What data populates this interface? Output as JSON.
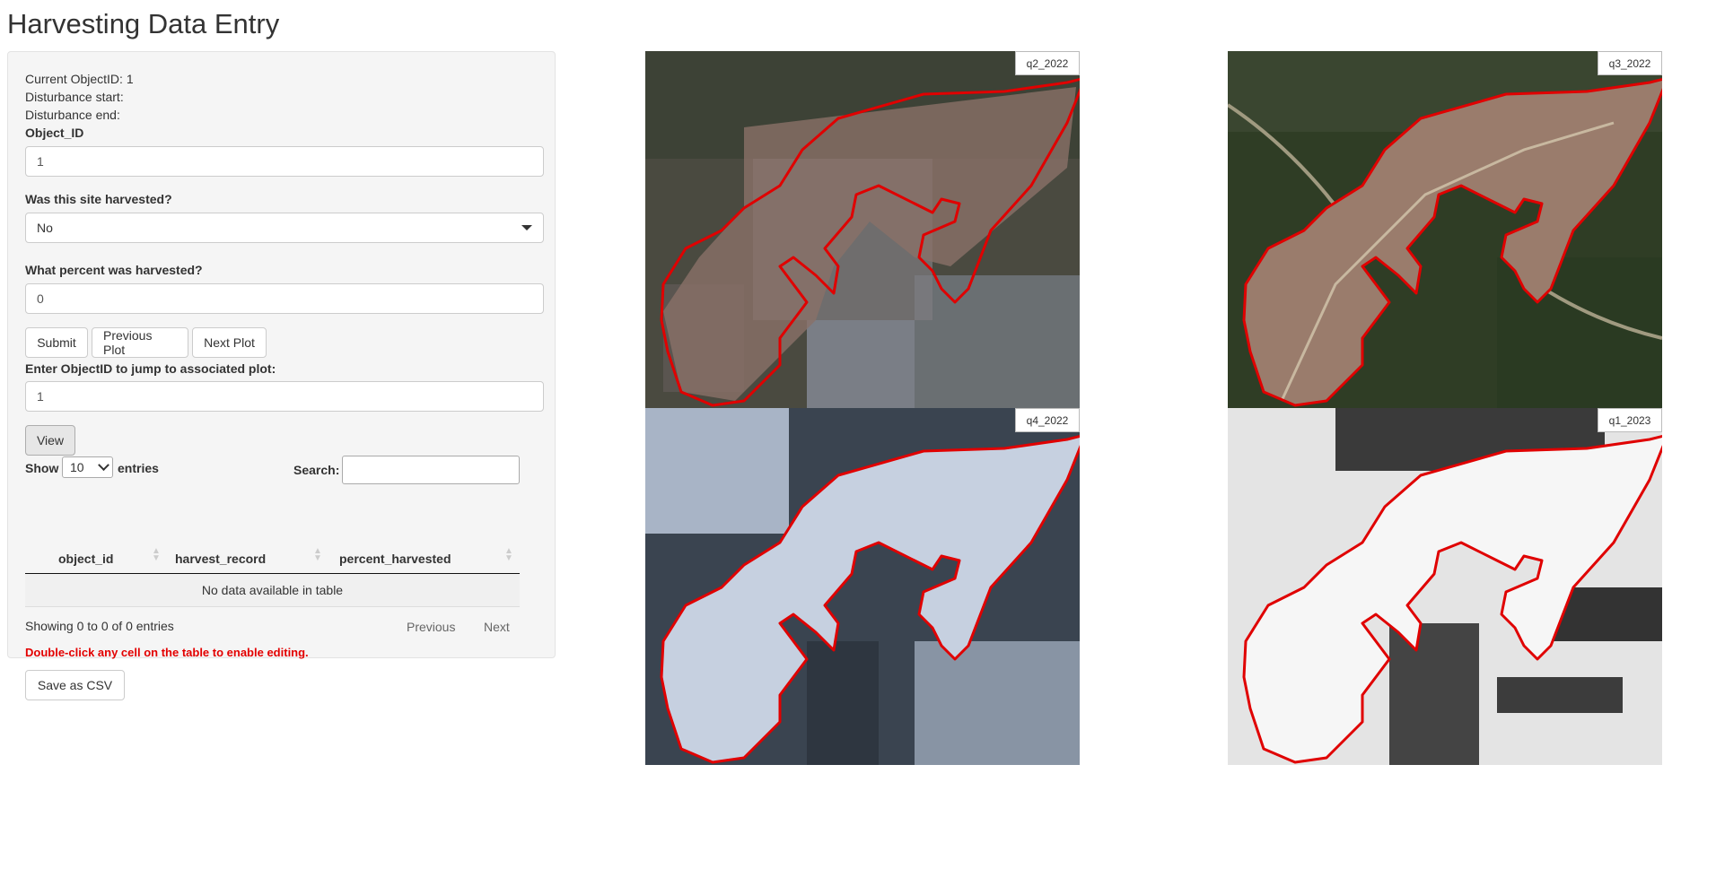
{
  "app": {
    "title": "Harvesting Data Entry"
  },
  "info": {
    "current_object": "Current ObjectID: 1",
    "disturbance_start": "Disturbance start:",
    "disturbance_end": "Disturbance end:"
  },
  "form": {
    "object_id_label": "Object_ID",
    "object_id_value": "1",
    "harvested_label": "Was this site harvested?",
    "harvested_value": "No",
    "percent_label": "What percent was harvested?",
    "percent_value": "0",
    "submit_label": "Submit",
    "previous_plot_label": "Previous Plot",
    "next_plot_label": "Next Plot",
    "jump_label": "Enter ObjectID to jump to associated plot:",
    "jump_value": "1",
    "view_label": "View"
  },
  "table": {
    "show_label": "Show",
    "length_value": "10",
    "entries_label": "entries",
    "search_label": "Search:",
    "search_value": "",
    "columns": [
      "object_id",
      "harvest_record",
      "percent_harvested"
    ],
    "empty_message": "No data available in table",
    "info": "Showing 0 to 0 of 0 entries",
    "previous_label": "Previous",
    "next_label": "Next"
  },
  "notice": "Double-click any cell on the table to enable editing.",
  "save_csv_label": "Save as CSV",
  "maps": [
    {
      "label": "q2_2022",
      "season": "summer-hazy"
    },
    {
      "label": "q3_2022",
      "season": "summer"
    },
    {
      "label": "q4_2022",
      "season": "winter"
    },
    {
      "label": "q1_2023",
      "season": "winter-snow"
    }
  ],
  "colors": {
    "polygon_outline": "#e00000",
    "notice_text": "#e30000",
    "panel_background": "#f5f5f5"
  }
}
